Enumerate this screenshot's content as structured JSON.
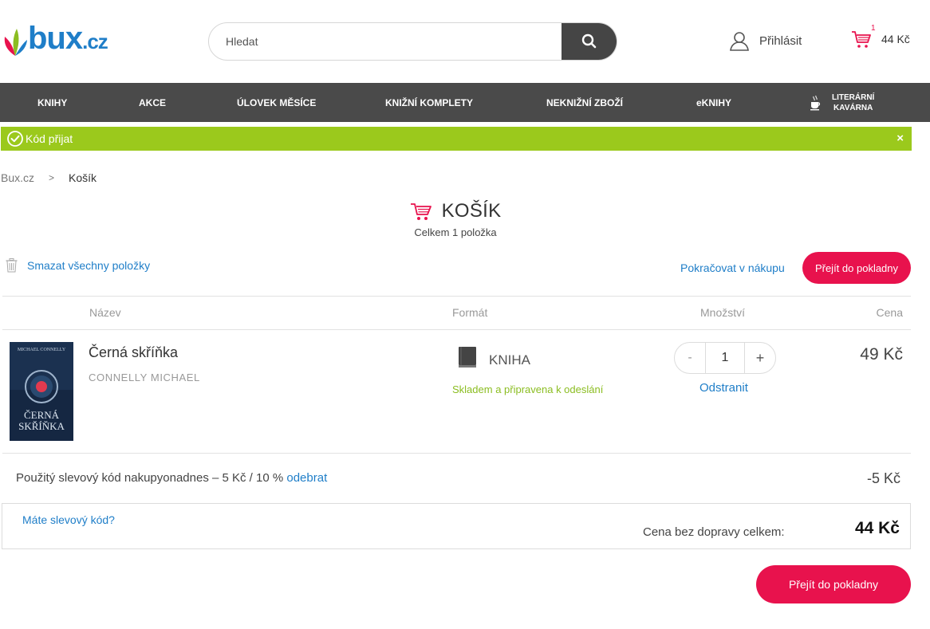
{
  "header": {
    "logo_text": "bux",
    "logo_suffix": ".cz",
    "search_placeholder": "Hledat",
    "login_label": "Přihlásit",
    "cart_count": "1",
    "cart_total": "44 Kč"
  },
  "nav": {
    "items": [
      {
        "label": "KNIHY"
      },
      {
        "label": "AKCE"
      },
      {
        "label": "ÚLOVEK MĚSÍCE"
      },
      {
        "label": "KNIŽNÍ KOMPLETY"
      },
      {
        "label": "NEKNIŽNÍ ZBOŽÍ"
      },
      {
        "label": "eKNIHY"
      },
      {
        "label_line1": "LITERÁRNÍ",
        "label_line2": "KAVÁRNA"
      }
    ]
  },
  "alert": {
    "text": "Kód přijat",
    "close": "×",
    "color": "#9bc91c"
  },
  "breadcrumb": {
    "home": "Bux.cz",
    "separator": ">",
    "current": "Košík"
  },
  "cart": {
    "title": "KOŠÍK",
    "subtitle": "Celkem 1 položka",
    "clear_all": "Smazat všechny položky",
    "continue_shopping": "Pokračovat v nákupu",
    "checkout": "Přejít do pokladny"
  },
  "table": {
    "columns": {
      "name": "Název",
      "format": "Formát",
      "quantity": "Množství",
      "price": "Cena"
    },
    "items": [
      {
        "title": "Černá skříňka",
        "author": "CONNELLY MICHAEL",
        "cover_author": "MICHAEL CONNELLY",
        "cover_title_line1": "ČERNÁ",
        "cover_title_line2": "SKŘÍŇKA",
        "format": "KNIHA",
        "stock": "Skladem a připravena k odeslání",
        "quantity": "1",
        "qty_minus": "-",
        "qty_plus": "+",
        "remove": "Odstranit",
        "price": "49 Kč"
      }
    ]
  },
  "discount": {
    "text": "Použitý slevový kód nakupyonadnes – 5 Kč / 10 % ",
    "remove": "odebrat",
    "value": "-5 Kč"
  },
  "summary": {
    "voucher_link": "Máte slevový kód?",
    "total_label": "Cena bez dopravy celkem:",
    "total_value": "44 Kč"
  },
  "colors": {
    "accent": "#e8124d",
    "link": "#1f7ec8",
    "nav_bg": "#4a4a4a",
    "success": "#9bc91c"
  }
}
